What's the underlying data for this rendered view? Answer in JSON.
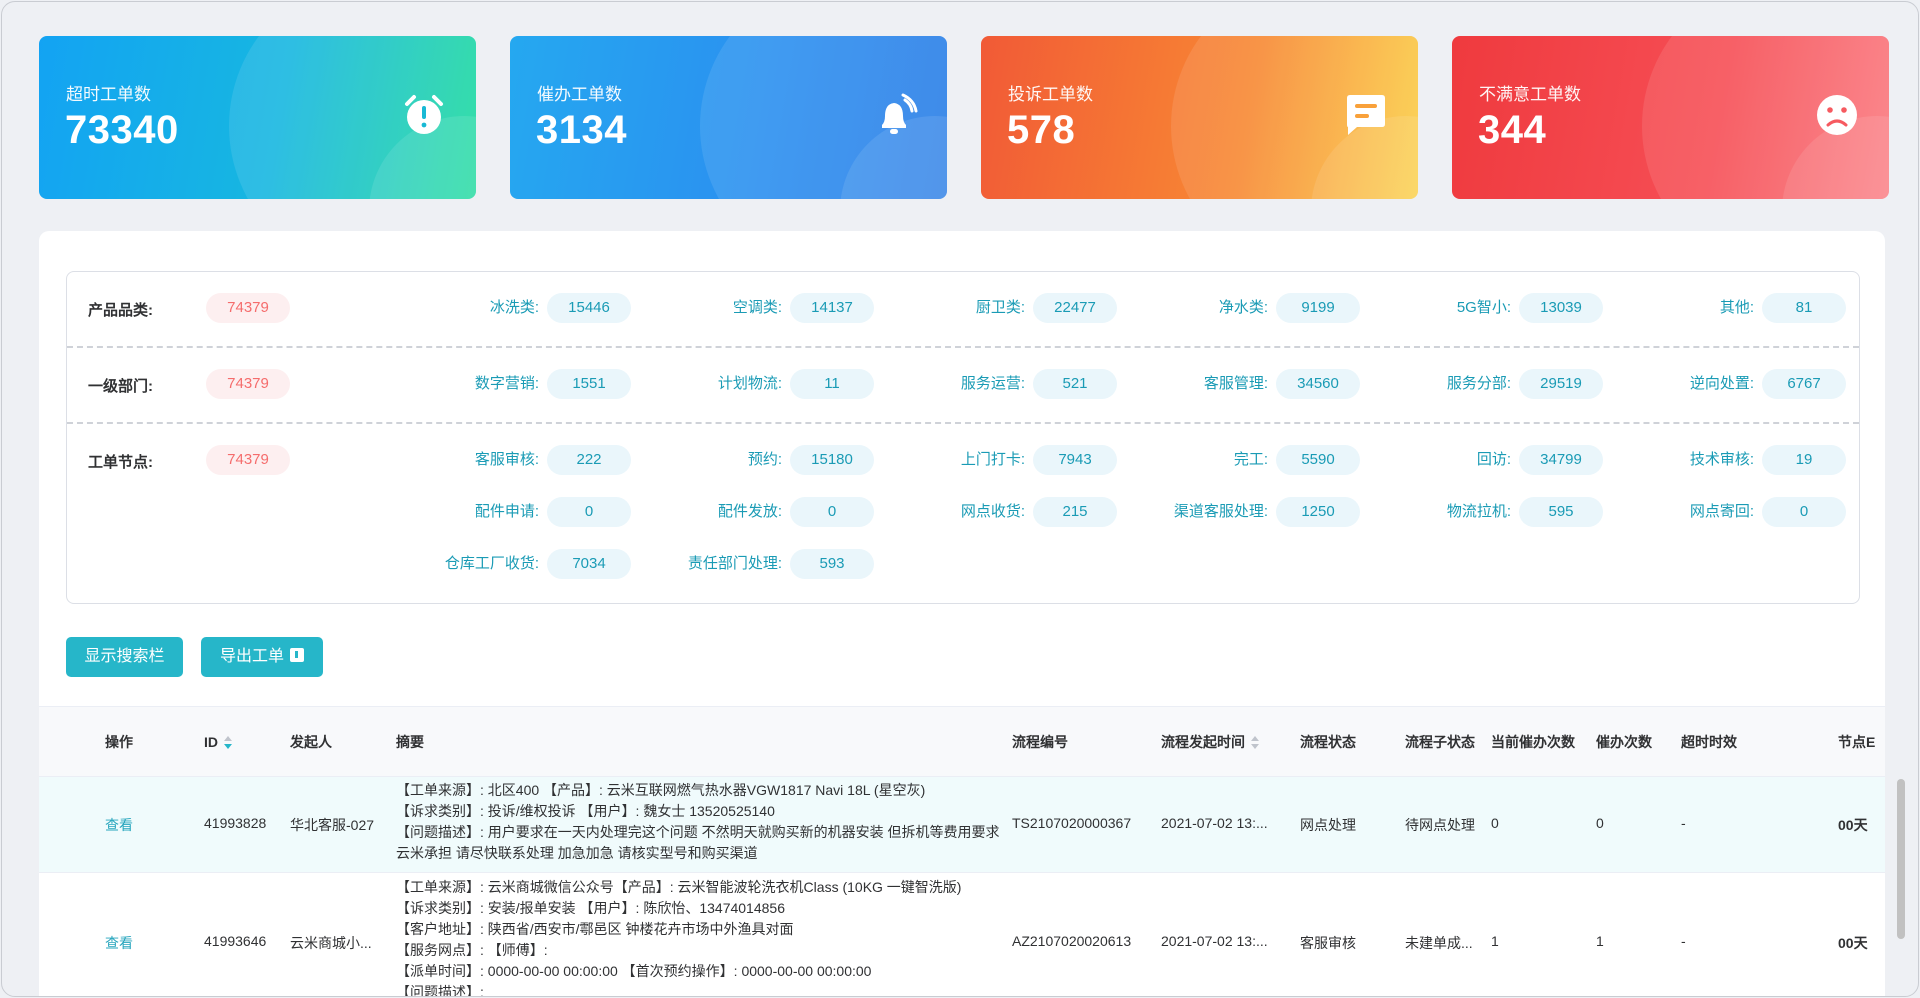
{
  "cards": [
    {
      "label": "超时工单数",
      "value": "73340",
      "icon": "alarm-clock-icon"
    },
    {
      "label": "催办工单数",
      "value": "3134",
      "icon": "bell-icon"
    },
    {
      "label": "投诉工单数",
      "value": "578",
      "icon": "message-icon"
    },
    {
      "label": "不满意工单数",
      "value": "344",
      "icon": "sad-face-icon"
    }
  ],
  "stats": {
    "product": {
      "label": "产品品类:",
      "total": "74379",
      "items": [
        {
          "k": "冰洗类:",
          "v": "15446"
        },
        {
          "k": "空调类:",
          "v": "14137"
        },
        {
          "k": "厨卫类:",
          "v": "22477"
        },
        {
          "k": "净水类:",
          "v": "9199"
        },
        {
          "k": "5G智小:",
          "v": "13039"
        },
        {
          "k": "其他:",
          "v": "81"
        }
      ]
    },
    "dept": {
      "label": "一级部门:",
      "total": "74379",
      "items": [
        {
          "k": "数字营销:",
          "v": "1551"
        },
        {
          "k": "计划物流:",
          "v": "11"
        },
        {
          "k": "服务运营:",
          "v": "521"
        },
        {
          "k": "客服管理:",
          "v": "34560"
        },
        {
          "k": "服务分部:",
          "v": "29519"
        },
        {
          "k": "逆向处置:",
          "v": "6767"
        }
      ]
    },
    "node": {
      "label": "工单节点:",
      "total": "74379",
      "items": [
        {
          "k": "客服审核:",
          "v": "222"
        },
        {
          "k": "预约:",
          "v": "15180"
        },
        {
          "k": "上门打卡:",
          "v": "7943"
        },
        {
          "k": "完工:",
          "v": "5590"
        },
        {
          "k": "回访:",
          "v": "34799"
        },
        {
          "k": "技术审核:",
          "v": "19"
        },
        {
          "k": "配件申请:",
          "v": "0"
        },
        {
          "k": "配件发放:",
          "v": "0"
        },
        {
          "k": "网点收货:",
          "v": "215"
        },
        {
          "k": "渠道客服处理:",
          "v": "1250"
        },
        {
          "k": "物流拉机:",
          "v": "595"
        },
        {
          "k": "网点寄回:",
          "v": "0"
        },
        {
          "k": "仓库工厂收货:",
          "v": "7034"
        },
        {
          "k": "责任部门处理:",
          "v": "593"
        }
      ]
    }
  },
  "buttons": {
    "show_search": "显示搜索栏",
    "export": "导出工单"
  },
  "table": {
    "headers": [
      "操作",
      "ID",
      "发起人",
      "摘要",
      "流程编号",
      "流程发起时间",
      "流程状态",
      "流程子状态",
      "当前催办次数",
      "催办次数",
      "超时时效",
      "节点E"
    ],
    "rows": [
      {
        "action": "查看",
        "id": "41993828",
        "initiator": "华北客服-027",
        "summary": [
          "【工单来源】: 北区400 【产品】: 云米互联网燃气热水器VGW1817 Navi 18L (星空灰)",
          "【诉求类别】: 投诉/维权投诉 【用户】: 魏女士 13520525140",
          "【问题描述】: 用户要求在一天内处理完这个问题 不然明天就购买新的机器安装 但拆机等费用要求",
          "云米承担 请尽快联系处理 加急加急 请核实型号和购买渠道"
        ],
        "flow_no": "TS2107020000367",
        "start_time": "2021-07-02 13:...",
        "status": "网点处理",
        "sub_status": "待网点处理",
        "cur_urge": "0",
        "urge": "0",
        "timeout": "-",
        "node": "00天"
      },
      {
        "action": "查看",
        "id": "41993646",
        "initiator": "云米商城小...",
        "summary": [
          "【工单来源】: 云米商城微信公众号【产品】: 云米智能波轮洗衣机Class (10KG 一键智洗版)",
          "【诉求类别】: 安装/报单安装 【用户】: 陈欣怡、13474014856",
          "【客户地址】: 陕西省/西安市/鄠邑区 钟楼花卉市场中外渔具对面",
          "【服务网点】: 【师傅】:",
          "【派单时间】: 0000-00-00 00:00:00 【首次预约操作】: 0000-00-00 00:00:00",
          "【问题描述】:"
        ],
        "flow_no": "AZ2107020020613",
        "start_time": "2021-07-02 13:...",
        "status": "客服审核",
        "sub_status": "未建单成...",
        "cur_urge": "1",
        "urge": "1",
        "timeout": "-",
        "node": "00天"
      }
    ]
  },
  "colors": {
    "accent": "#26b6c9",
    "danger": "#f56c6c"
  }
}
